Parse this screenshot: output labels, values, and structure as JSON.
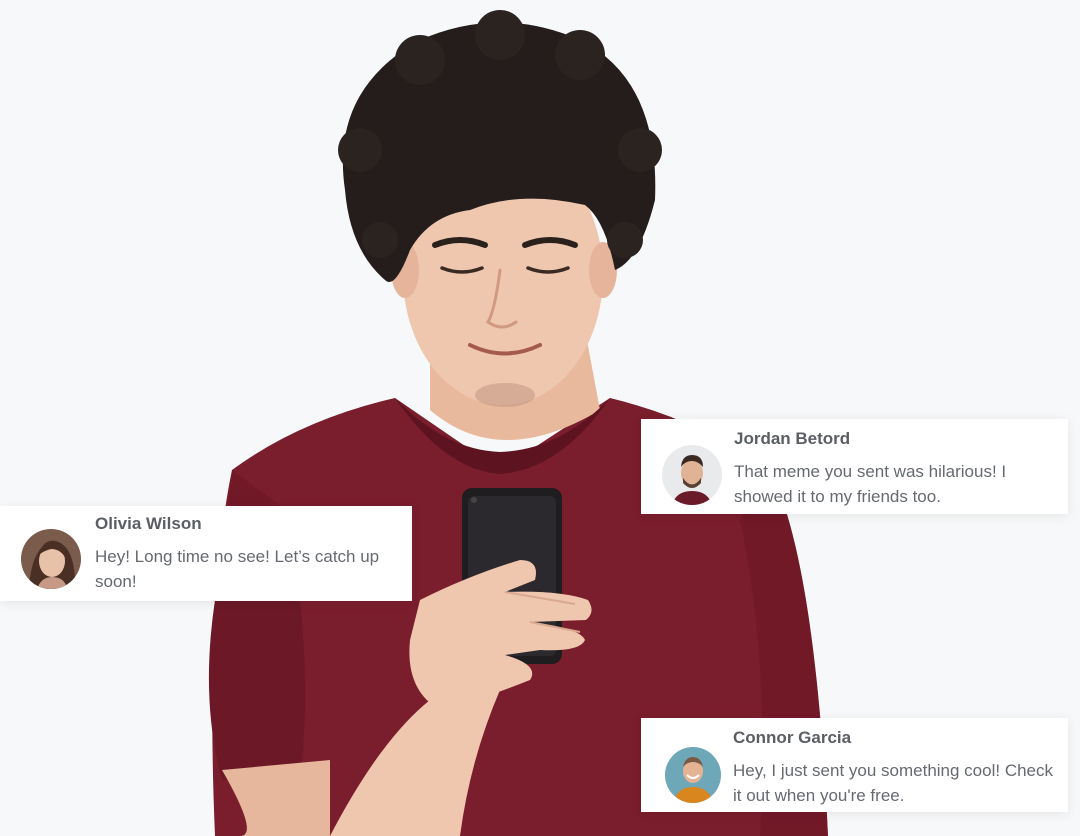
{
  "notifications": [
    {
      "name": "Olivia Wilson",
      "message": "Hey! Long time no see! Let’s catch up soon!"
    },
    {
      "name": "Jordan Betord",
      "message": "That meme you sent was hilarious! I showed it to my friends too."
    },
    {
      "name": "Connor Garcia",
      "message": "Hey, I just sent you something cool! Check it out when you're free."
    }
  ],
  "colors": {
    "background": "#f7f8f9",
    "shirt": "#7a1d2c",
    "skin": "#efc6ae",
    "hair": "#241d1b",
    "phone": "#1f1d20",
    "card": "#ffffff",
    "name_text": "#5b5e63",
    "message_text": "#666a70"
  }
}
